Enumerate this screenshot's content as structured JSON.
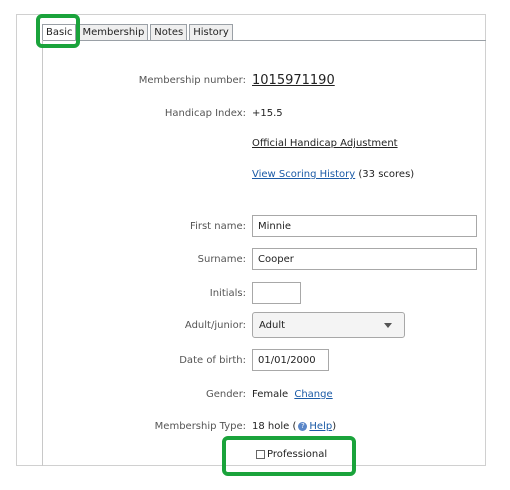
{
  "tabs": [
    "Basic",
    "Membership",
    "Notes",
    "History"
  ],
  "fields": {
    "membership_number_label": "Membership number:",
    "membership_number": "1015971190",
    "handicap_label": "Handicap Index:",
    "handicap_value": "+15.5",
    "official_link": "Official Handicap Adjustment",
    "scoring_link": "View Scoring History",
    "scoring_count": "(33 scores)",
    "first_name_label": "First name:",
    "first_name": "Minnie",
    "surname_label": "Surname:",
    "surname": "Cooper",
    "initials_label": "Initials:",
    "initials": "",
    "adult_label": "Adult/junior:",
    "adult_value": "Adult",
    "dob_label": "Date of birth:",
    "dob": "01/01/2000",
    "gender_label": "Gender:",
    "gender_value": "Female",
    "change_link": "Change",
    "membership_type_label": "Membership Type:",
    "membership_type_value": "18 hole",
    "help_open": "(",
    "help_link": "Help",
    "help_close": ")",
    "professional_label": "Professional"
  },
  "colors": {
    "highlight": "#1aa33b",
    "link": "#1a5aa6"
  }
}
